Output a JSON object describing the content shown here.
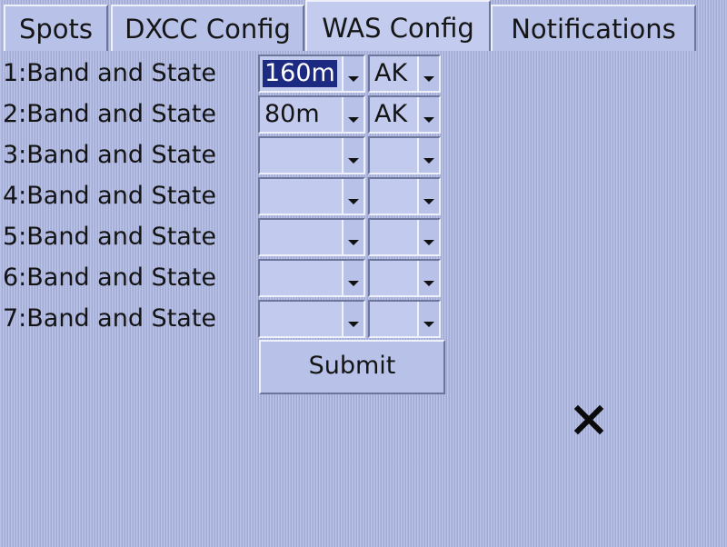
{
  "tabs": [
    {
      "label": "Spots",
      "active": false
    },
    {
      "label": "DXCC Config",
      "active": false
    },
    {
      "label": "WAS Config",
      "active": true
    },
    {
      "label": "Notifications",
      "active": false
    }
  ],
  "rows": [
    {
      "label": "1:Band and State",
      "band": "160m",
      "state": "AK",
      "band_selected": true
    },
    {
      "label": "2:Band and State",
      "band": "80m",
      "state": "AK",
      "band_selected": false
    },
    {
      "label": "3:Band and State",
      "band": "",
      "state": ""
    },
    {
      "label": "4:Band and State",
      "band": "",
      "state": ""
    },
    {
      "label": "5:Band and State",
      "band": "",
      "state": ""
    },
    {
      "label": "6:Band and State",
      "band": "",
      "state": ""
    },
    {
      "label": "7:Band and State",
      "band": "",
      "state": ""
    }
  ],
  "submit_label": "Submit",
  "icons": {
    "close": "close-icon",
    "dropdown": "chevron-down-icon"
  },
  "colors": {
    "background": "#b3bde6",
    "selection": "#1c2a82"
  }
}
